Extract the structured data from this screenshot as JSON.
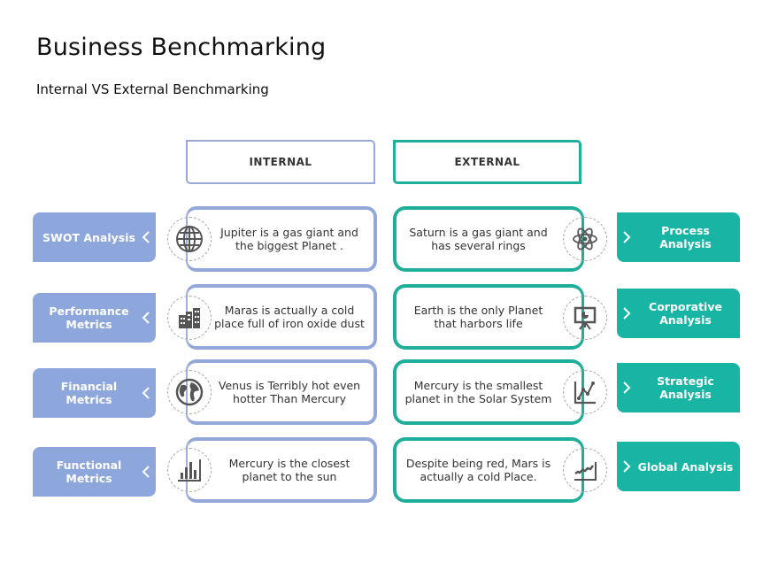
{
  "header": {
    "title": "Business Benchmarking",
    "subtitle": "Internal VS External Benchmarking"
  },
  "columns": {
    "internal": "INTERNAL",
    "external": "EXTERNAL"
  },
  "colors": {
    "internal_accent": "#8da6dc",
    "external_accent": "#19b5a4"
  },
  "rows": [
    {
      "internal_label": "SWOT Analysis",
      "internal_icon": "globe-icon",
      "internal_text": "Jupiter is a gas giant and the biggest Planet  .",
      "external_text": "Saturn is a gas giant and has several  rings",
      "external_icon": "atom-icon",
      "external_label": "Process Analysis"
    },
    {
      "internal_label": "Performance Metrics",
      "internal_icon": "buildings-icon",
      "internal_text": "Maras is actually  a cold place full  of iron oxide dust",
      "external_text": "Earth is  the only  Planet that harbors life",
      "external_icon": "presentation-board-icon",
      "external_label": "Corporative Analysis"
    },
    {
      "internal_label": "Financial Metrics",
      "internal_icon": "earth-icon",
      "internal_text": "Venus is Terribly  hot even hotter Than Mercury",
      "external_text": "Mercury  is the smallest planet in the Solar System",
      "external_icon": "line-chart-icon",
      "external_label": "Strategic Analysis"
    },
    {
      "internal_label": "Functional Metrics",
      "internal_icon": "bar-chart-icon",
      "internal_text": "Mercury  is the closest planet to the sun",
      "external_text": "Despite being red, Mars is actually  a cold Place.",
      "external_icon": "trend-chart-icon",
      "external_label": "Global Analysis"
    }
  ]
}
